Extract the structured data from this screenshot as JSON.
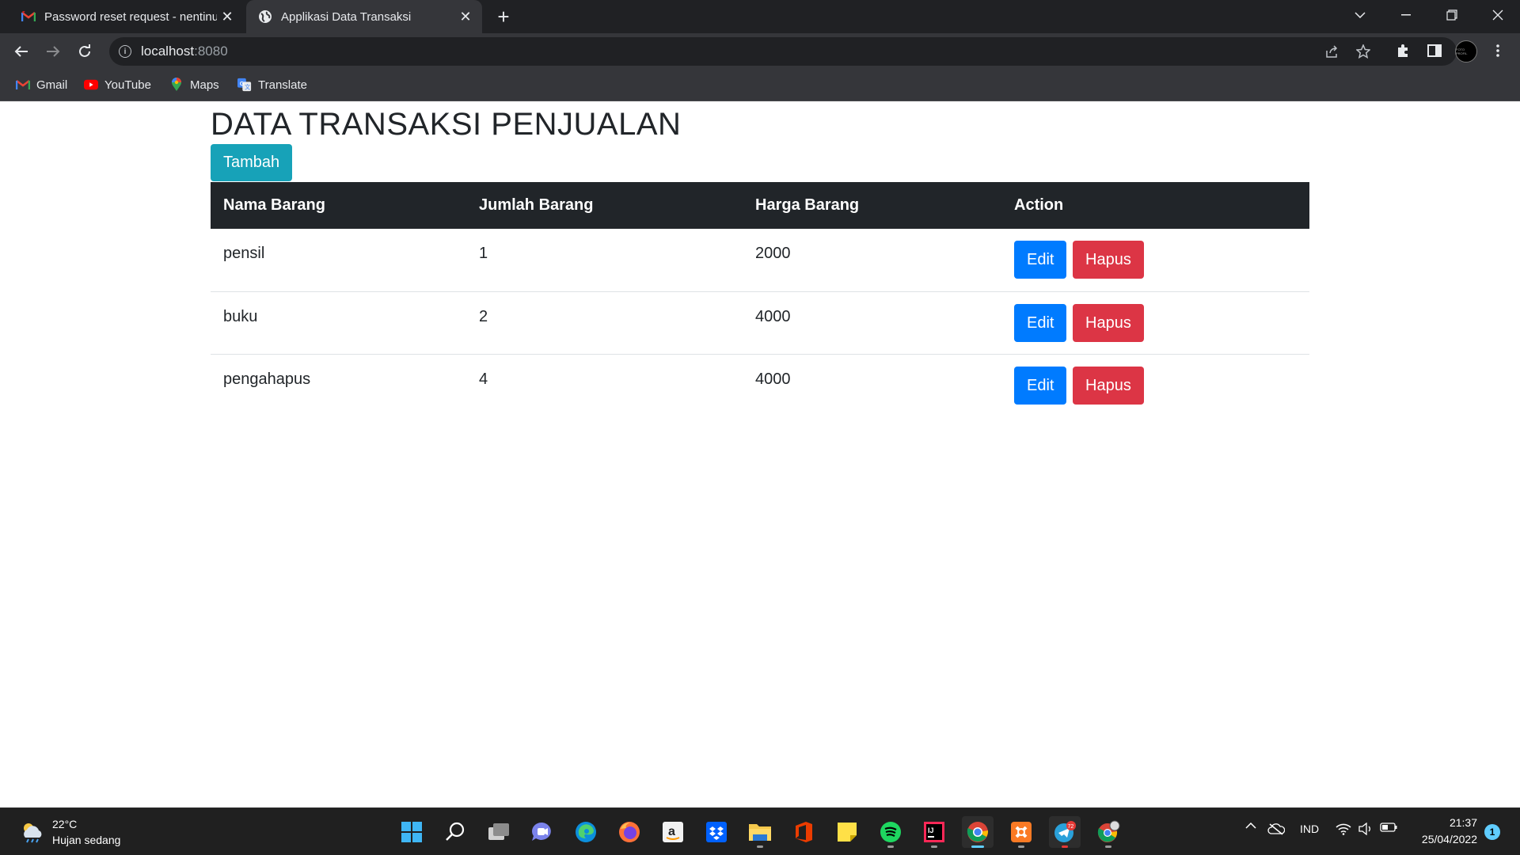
{
  "browser": {
    "tabs": [
      {
        "title": "Password reset request - nentinu",
        "icon": "gmail-icon",
        "active": false
      },
      {
        "title": "Applikasi Data Transaksi",
        "icon": "globe-icon",
        "active": true
      }
    ],
    "address": {
      "host": "localhost",
      "port": ":8080"
    },
    "bookmarks": [
      {
        "label": "Gmail",
        "icon": "gmail-icon"
      },
      {
        "label": "YouTube",
        "icon": "youtube-icon"
      },
      {
        "label": "Maps",
        "icon": "maps-icon"
      },
      {
        "label": "Translate",
        "icon": "translate-icon"
      }
    ],
    "avatar_text": "FOTO PROFIL"
  },
  "page": {
    "title": "DATA TRANSAKSI PENJUALAN",
    "add_button": "Tambah",
    "table": {
      "headers": [
        "Nama Barang",
        "Jumlah Barang",
        "Harga Barang",
        "Action"
      ],
      "rows": [
        {
          "nama": "pensil",
          "jumlah": "1",
          "harga": "2000"
        },
        {
          "nama": "buku",
          "jumlah": "2",
          "harga": "4000"
        },
        {
          "nama": "pengahapus",
          "jumlah": "4",
          "harga": "4000"
        }
      ],
      "edit_label": "Edit",
      "delete_label": "Hapus"
    },
    "colors": {
      "tambah": "#17a2b8",
      "edit": "#007bff",
      "hapus": "#dc3545",
      "header": "#212529"
    }
  },
  "taskbar": {
    "weather": {
      "temp": "22°C",
      "desc": "Hujan sedang"
    },
    "language": "IND",
    "time": "21:37",
    "date": "25/04/2022",
    "notification_count": "1",
    "telegram_badge": "72"
  }
}
